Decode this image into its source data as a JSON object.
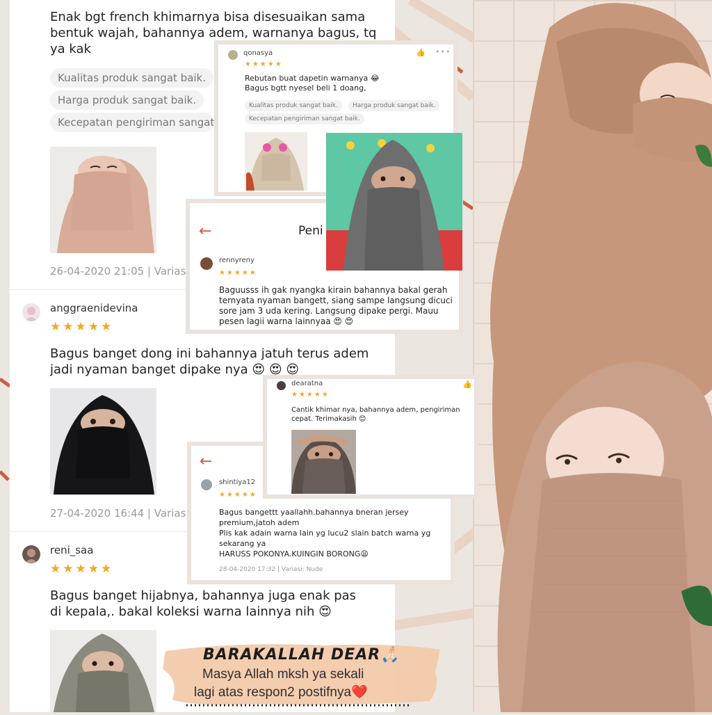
{
  "main": {
    "review1": {
      "text": "Enak bgt french khimarnya bisa disesuaikan sama bentuk wajah, bahannya adem, warnanya bagus, tq ya kak",
      "tags": [
        "Kualitas produk sangat baik.",
        "Harga produk sangat baik.",
        "Kecepatan pengiriman sangat"
      ],
      "date": "26-04-2020 21:05 | Varias"
    },
    "review2": {
      "username": "anggraenidevina",
      "stars": "★★★★★",
      "text": "Bagus banget dong ini bahannya jatuh terus adem jadi nyaman banget dipake nya 😍 😍 😍",
      "date": "27-04-2020 16:44 | Varias"
    },
    "review3": {
      "username": "reni_saa",
      "stars": "★★★★★",
      "text": "Bagus banget hijabnya, bahannya juga enak pas di kepala,. bakal koleksi warna lainnya nih 😍"
    }
  },
  "cards": {
    "qonasya": {
      "username": "qonasya",
      "stars": "★★★★★",
      "text": "Rebutan buat dapetin warnanya 😂\nBagus bgtt nyesel beli 1 doang,",
      "tags": [
        "Kualitas produk sangat baik.",
        "Harga produk sangat baik.",
        "Kecepatan pengiriman sangat baik."
      ]
    },
    "rennyreny": {
      "header": "Peni",
      "username": "rennyreny",
      "stars": "★★★★★",
      "text": "Baguusss ih gak nyangka kirain bahannya bakal gerah ternyata nyaman bangett, siang sampe langsung dicuci sore jam 3 uda kering. Langsung dipake pergi. Mauu pesen lagii warna lainnyaa 😍 😍"
    },
    "dearatna": {
      "username": "dearatna",
      "stars": "★★★★★",
      "text": "Cantik  khimar nya,  bahannya adem,  pengiriman cepat. Terimakasih 😊"
    },
    "shintiya12": {
      "username": "shintiya12",
      "stars": "★★★★★",
      "text": "Bagus bangettt yaallahh.bahannya bneran jersey premium,jatoh adem\nPlis kak adain warna lain yg lucu2 slain batch warna yg sekarang ya\nHARUSS POKONYA.KUINGIN BORONG😩",
      "date": "28-04-2020 17:32 | Variasi: Nude"
    }
  },
  "banner": {
    "title": "BARAKALLAH DEAR🙏🏻",
    "line1": "Masya Allah mksh ya sekali",
    "line2": "lagi atas respon2 postifnya❤️"
  },
  "icons": {
    "back": "arrow-left-icon",
    "like": "thumbs-up-icon",
    "more": "more-dots-icon",
    "star": "star-icon"
  },
  "colors": {
    "star": "#f5a623",
    "accent": "#d9543b",
    "khimar_nude": "#c79b7e",
    "background": "#ece6e0"
  }
}
